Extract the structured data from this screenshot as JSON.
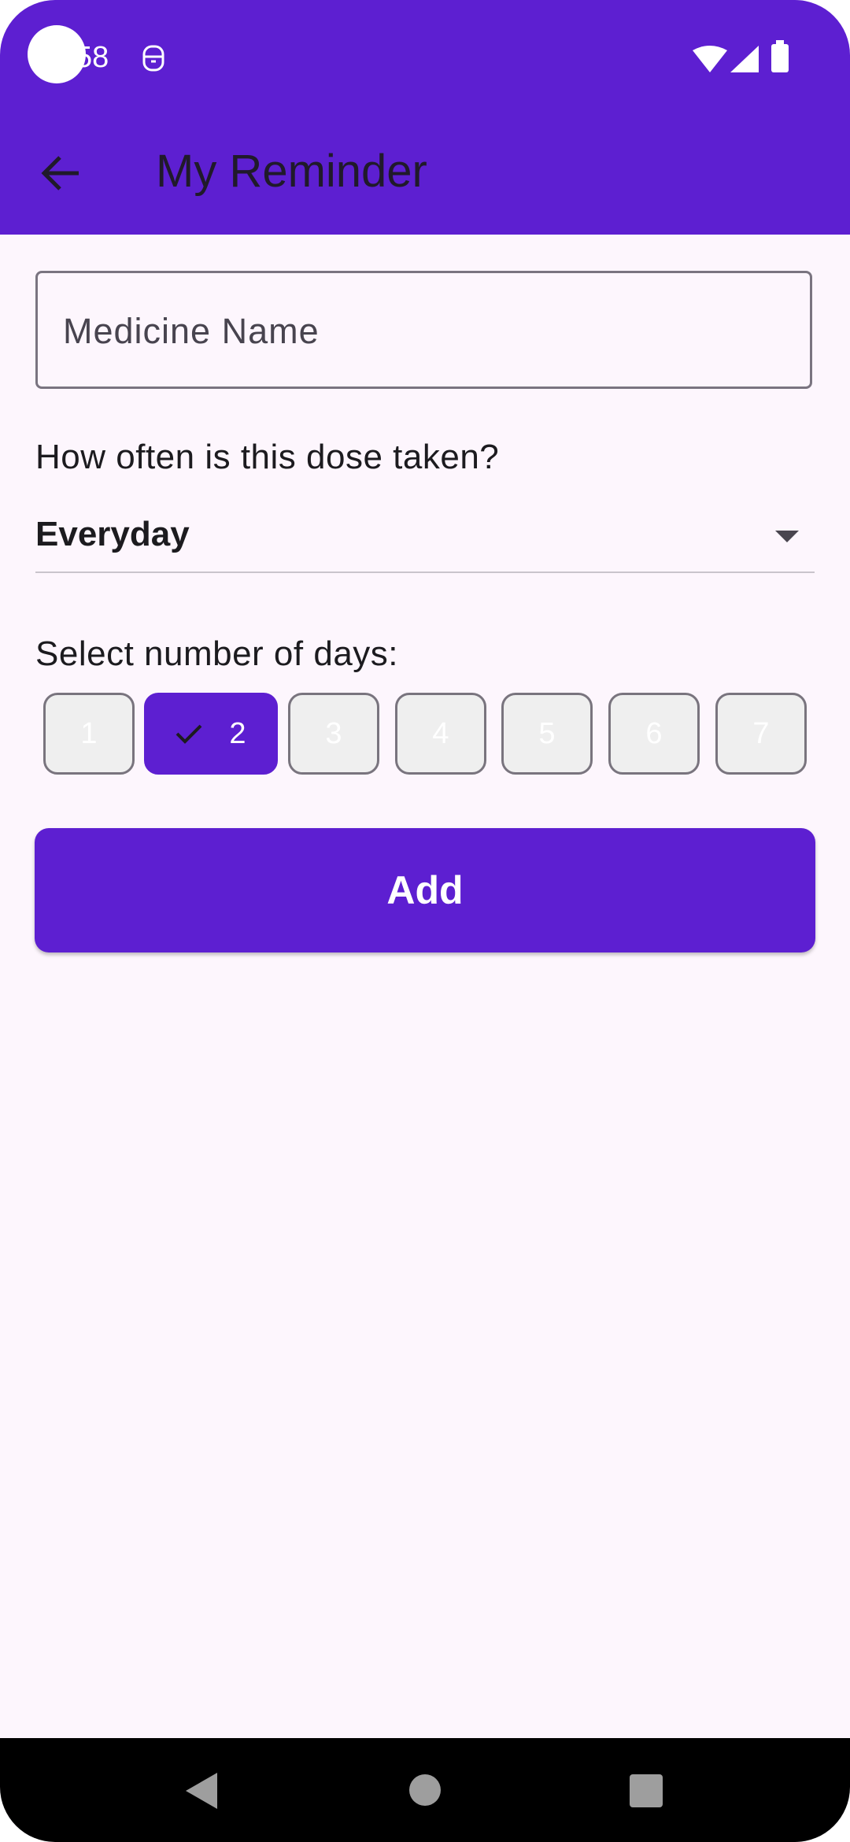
{
  "status_bar": {
    "time": "58"
  },
  "app_bar": {
    "title": "My Reminder"
  },
  "form": {
    "medicine_placeholder": "Medicine Name",
    "frequency_question": "How often is this dose taken?",
    "frequency_value": "Everyday",
    "days_label": "Select number of days:",
    "day_options": [
      "1",
      "2",
      "3",
      "4",
      "5",
      "6",
      "7"
    ],
    "selected_day": "2",
    "add_label": "Add"
  },
  "colors": {
    "primary": "#5d1fd1",
    "background": "#fdf6fd",
    "chip_unselected": "#efefef"
  }
}
